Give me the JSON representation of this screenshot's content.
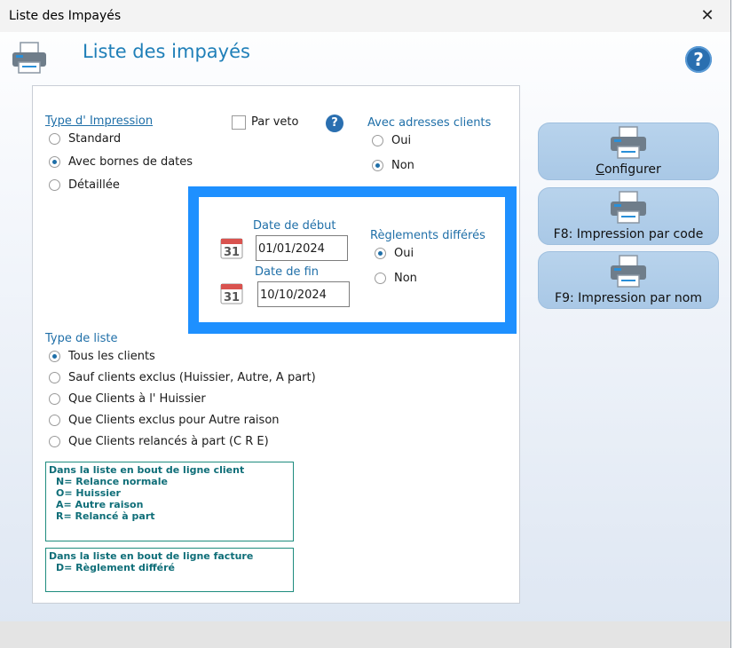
{
  "window": {
    "title": "Liste des Impayés",
    "close_glyph": "✕"
  },
  "header": {
    "title": "Liste des impayés",
    "help_glyph": "?"
  },
  "type_impression": {
    "label": "Type d' Impression",
    "options": [
      "Standard",
      "Avec bornes de dates",
      "Détaillée"
    ],
    "selected": 1
  },
  "par_veto": {
    "label": "Par veto",
    "checked": false
  },
  "adresses": {
    "label": "Avec adresses clients",
    "options": [
      "Oui",
      "Non"
    ],
    "selected": 1
  },
  "dates": {
    "debut_label": "Date de début",
    "debut_value": "01/01/2024",
    "fin_label": "Date de fin",
    "fin_value": "10/10/2024",
    "cal_glyph": "31"
  },
  "reglements": {
    "label": "Règlements différés",
    "options": [
      "Oui",
      "Non"
    ],
    "selected": 0
  },
  "type_liste": {
    "label": "Type de liste",
    "options": [
      "Tous les clients",
      "Sauf clients exclus (Huissier, Autre, A part)",
      "Que Clients à l' Huissier",
      "Que Clients exclus pour Autre raison",
      "Que Clients relancés à part (C R E)"
    ],
    "selected": 0
  },
  "legend_client": {
    "title": "Dans la liste en bout de ligne client",
    "lines": [
      "N= Relance normale",
      "O= Huissier",
      "A= Autre raison",
      "R= Relancé à part"
    ]
  },
  "legend_facture": {
    "title": "Dans la liste en bout de ligne facture",
    "lines": [
      "D= Règlement différé"
    ]
  },
  "buttons": {
    "configurer": "Configurer",
    "par_code": "F8: Impression par code",
    "par_nom": "F9: Impression par nom"
  },
  "colors": {
    "accent": "#1f6fa8",
    "datebox_border": "#1e90ff",
    "button_bg": "#b0cde9"
  },
  "icons": {
    "printer": "printer-icon",
    "calendar": "calendar-icon",
    "help": "help-icon",
    "close": "close-icon"
  }
}
